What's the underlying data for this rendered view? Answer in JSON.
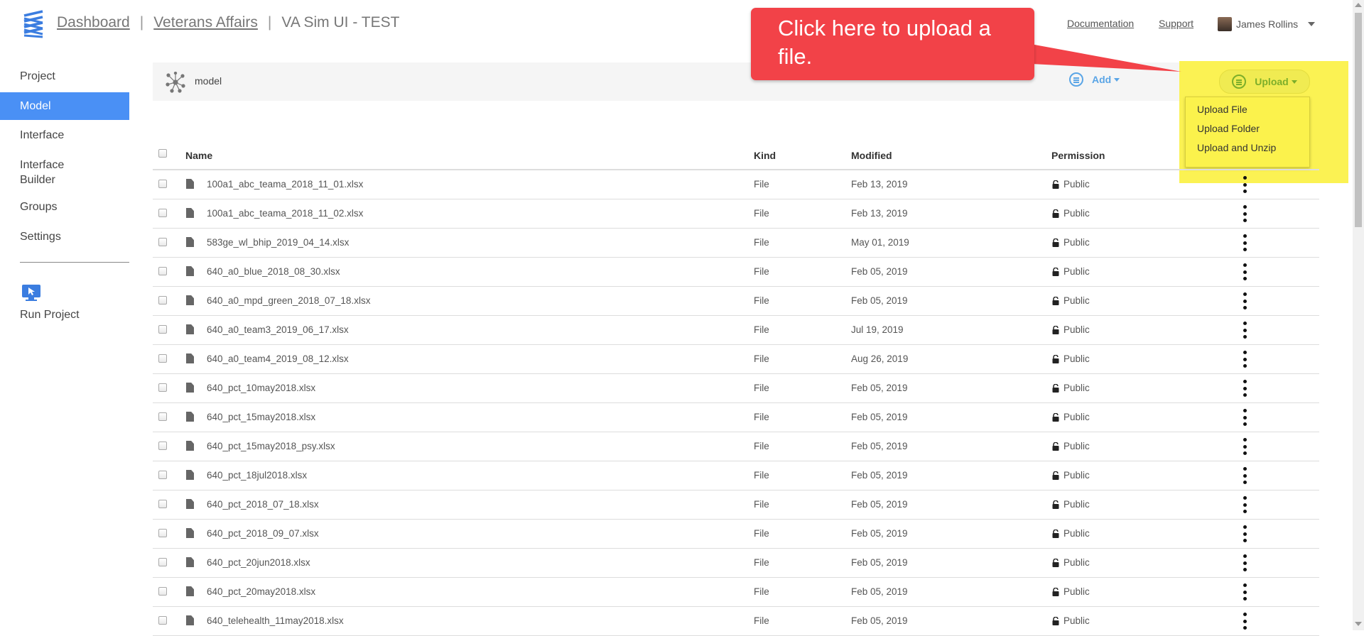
{
  "header": {
    "breadcrumb": [
      "Dashboard",
      "Veterans Affairs"
    ],
    "separator": "|",
    "current": "VA Sim UI - TEST",
    "documentation": "Documentation",
    "support": "Support",
    "user": "James Rollins"
  },
  "sidebar": {
    "items": [
      {
        "label": "Project"
      },
      {
        "label": "Model"
      },
      {
        "label": "Interface"
      },
      {
        "label": "Interface\nBuilder"
      },
      {
        "label": "Groups"
      },
      {
        "label": "Settings"
      }
    ],
    "run_label": "Run Project"
  },
  "toolbar": {
    "folder_label": "model",
    "add_label": "Add",
    "upload_label": "Upload",
    "upload_menu": [
      "Upload File",
      "Upload Folder",
      "Upload and Unzip"
    ]
  },
  "callout": {
    "text": "Click here to upload a file."
  },
  "table": {
    "columns": [
      "Name",
      "Kind",
      "Modified",
      "Permission"
    ],
    "rows": [
      {
        "name": "100a1_abc_teama_2018_11_01.xlsx",
        "kind": "File",
        "modified": "Feb 13, 2019",
        "permission": "Public"
      },
      {
        "name": "100a1_abc_teama_2018_11_02.xlsx",
        "kind": "File",
        "modified": "Feb 13, 2019",
        "permission": "Public"
      },
      {
        "name": "583ge_wl_bhip_2019_04_14.xlsx",
        "kind": "File",
        "modified": "May 01, 2019",
        "permission": "Public"
      },
      {
        "name": "640_a0_blue_2018_08_30.xlsx",
        "kind": "File",
        "modified": "Feb 05, 2019",
        "permission": "Public"
      },
      {
        "name": "640_a0_mpd_green_2018_07_18.xlsx",
        "kind": "File",
        "modified": "Feb 05, 2019",
        "permission": "Public"
      },
      {
        "name": "640_a0_team3_2019_06_17.xlsx",
        "kind": "File",
        "modified": "Jul 19, 2019",
        "permission": "Public"
      },
      {
        "name": "640_a0_team4_2019_08_12.xlsx",
        "kind": "File",
        "modified": "Aug 26, 2019",
        "permission": "Public"
      },
      {
        "name": "640_pct_10may2018.xlsx",
        "kind": "File",
        "modified": "Feb 05, 2019",
        "permission": "Public"
      },
      {
        "name": "640_pct_15may2018.xlsx",
        "kind": "File",
        "modified": "Feb 05, 2019",
        "permission": "Public"
      },
      {
        "name": "640_pct_15may2018_psy.xlsx",
        "kind": "File",
        "modified": "Feb 05, 2019",
        "permission": "Public"
      },
      {
        "name": "640_pct_18jul2018.xlsx",
        "kind": "File",
        "modified": "Feb 05, 2019",
        "permission": "Public"
      },
      {
        "name": "640_pct_2018_07_18.xlsx",
        "kind": "File",
        "modified": "Feb 05, 2019",
        "permission": "Public"
      },
      {
        "name": "640_pct_2018_09_07.xlsx",
        "kind": "File",
        "modified": "Feb 05, 2019",
        "permission": "Public"
      },
      {
        "name": "640_pct_20jun2018.xlsx",
        "kind": "File",
        "modified": "Feb 05, 2019",
        "permission": "Public"
      },
      {
        "name": "640_pct_20may2018.xlsx",
        "kind": "File",
        "modified": "Feb 05, 2019",
        "permission": "Public"
      },
      {
        "name": "640_telehealth_11may2018.xlsx",
        "kind": "File",
        "modified": "Feb 05, 2019",
        "permission": "Public"
      }
    ]
  },
  "colors": {
    "accent": "#4a90f5",
    "highlight": "#fbf14a",
    "callout": "#f24248",
    "add": "#5aa5e6",
    "upload": "#7cae2a"
  }
}
